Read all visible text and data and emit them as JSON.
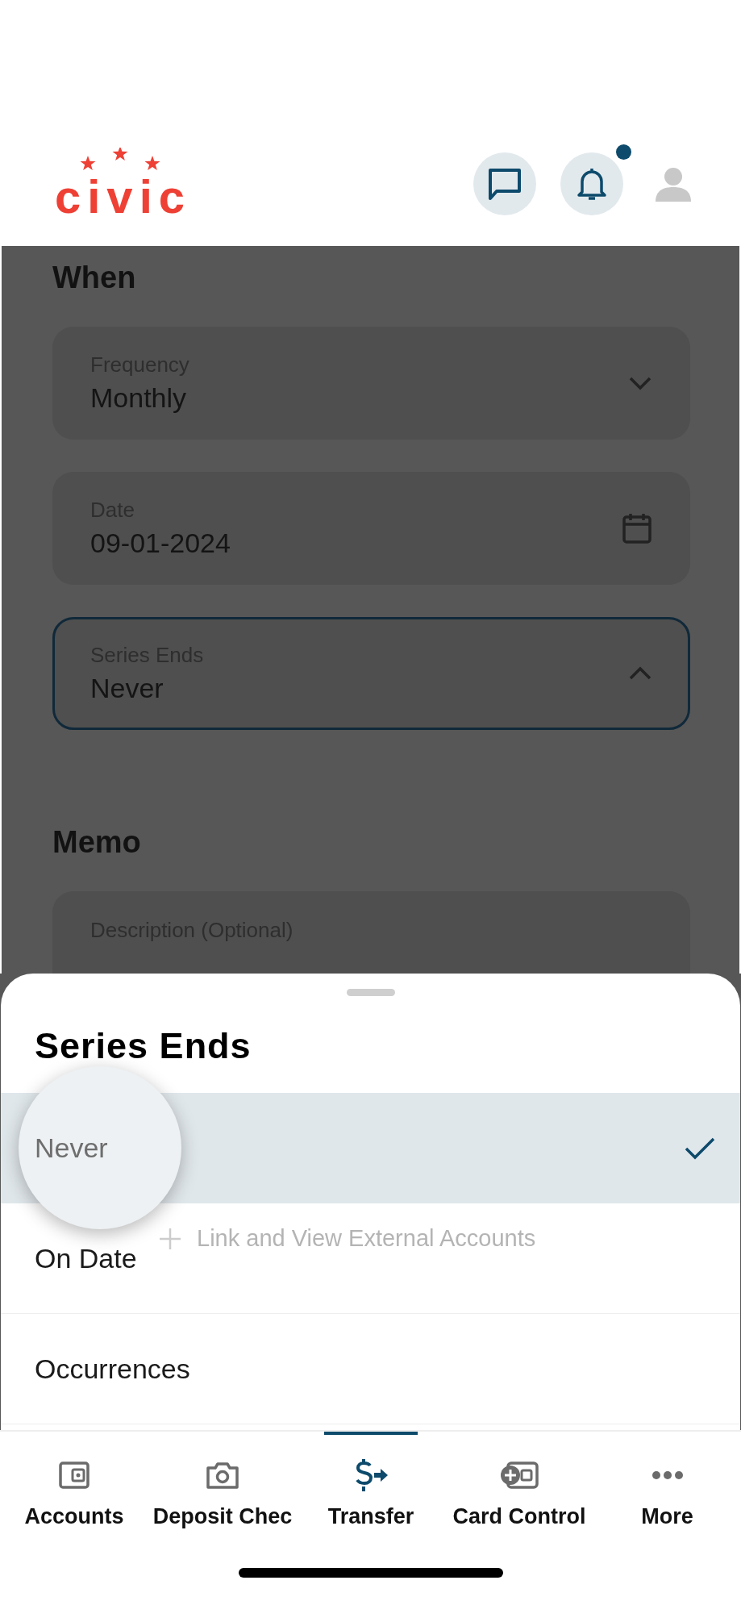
{
  "header": {
    "logo": "civic",
    "notification_badge": true
  },
  "form": {
    "sections": [
      {
        "heading": "When",
        "fields": [
          {
            "kind": "dropdown",
            "label": "Frequency",
            "value": "Monthly",
            "focused": false,
            "expanded": false
          },
          {
            "kind": "date",
            "label": "Date",
            "value": "09-01-2024",
            "focused": false
          },
          {
            "kind": "dropdown",
            "label": "Series Ends",
            "value": "Never",
            "focused": true,
            "expanded": true
          }
        ]
      },
      {
        "heading": "Memo",
        "fields": [
          {
            "kind": "text",
            "placeholder": "Description (Optional)",
            "focused": false
          }
        ]
      }
    ]
  },
  "sheet": {
    "title": "Series Ends",
    "background_link": "Link and View External Accounts",
    "options": [
      {
        "label": "Never",
        "selected": true,
        "touched": true
      },
      {
        "label": "On Date",
        "selected": false,
        "touched": false
      },
      {
        "label": "Occurrences",
        "selected": false,
        "touched": false
      }
    ]
  },
  "nav": [
    {
      "kind": "accounts",
      "label": "Accounts",
      "selected": false
    },
    {
      "kind": "deposit",
      "label": "Deposit Chec",
      "selected": false
    },
    {
      "kind": "transfer",
      "label": "Transfer",
      "selected": true
    },
    {
      "kind": "cards",
      "label": "Card Control",
      "selected": false
    },
    {
      "kind": "more",
      "label": "More",
      "selected": false
    }
  ]
}
